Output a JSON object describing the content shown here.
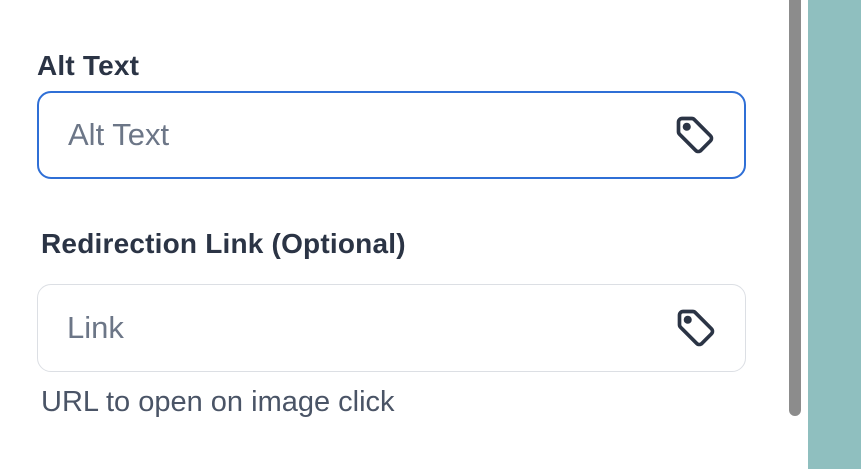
{
  "alt_text": {
    "label": "Alt Text",
    "placeholder": "Alt Text",
    "value": "",
    "icon": "tag-icon"
  },
  "redirection_link": {
    "label": "Redirection Link (Optional)",
    "placeholder": "Link",
    "value": "",
    "icon": "tag-icon",
    "help": "URL to open on image click"
  },
  "colors": {
    "focus_border": "#2f6fd6",
    "side_background": "#8fbfbf"
  }
}
